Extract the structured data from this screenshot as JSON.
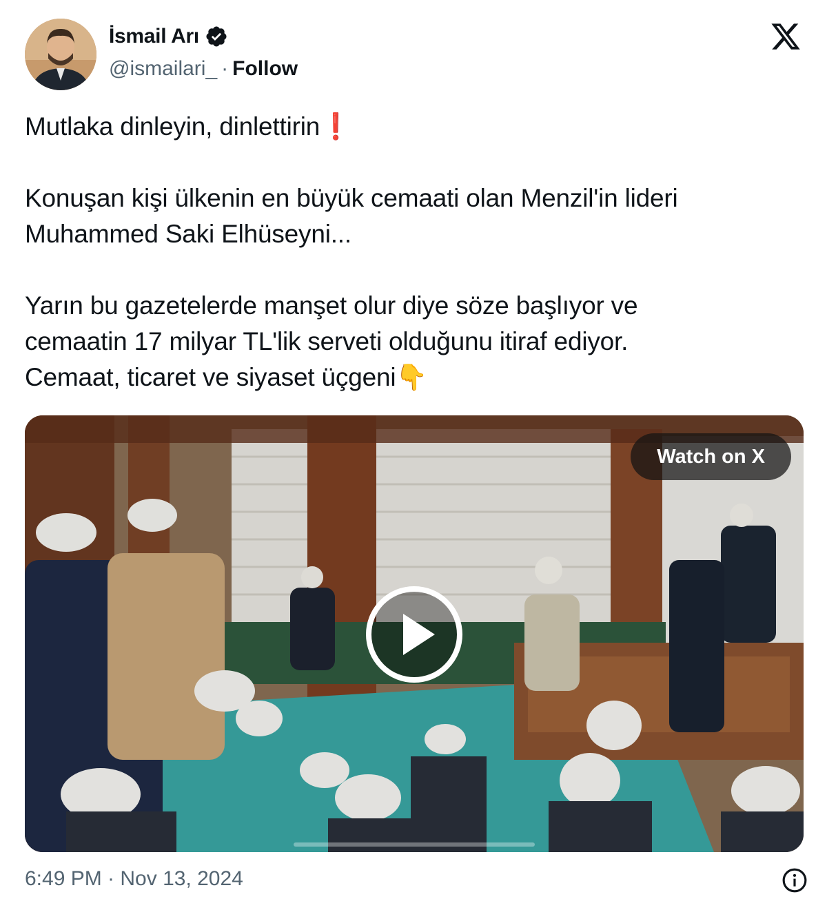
{
  "author": {
    "name": "İsmail Arı",
    "handle": "@ismailari_",
    "separator": "·",
    "follow_label": "Follow",
    "verified": true,
    "avatar_icon": "profile-photo"
  },
  "platform_icon": "x-logo-icon",
  "tweet": {
    "line1": "Mutlaka dinleyin, dinlettirin",
    "line1_emoji": "❗",
    "para2_line1": "Konuşan kişi ülkenin en büyük cemaati olan Menzil'in lideri",
    "para2_line2": "Muhammed Saki Elhüseyni...",
    "para3_line1": "Yarın bu gazetelerde manşet olur diye söze başlıyor ve",
    "para3_line2": "cemaatin 17 milyar TL'lik serveti olduğunu itiraf ediyor.",
    "para3_line3": "Cemaat, ticaret ve siyaset üçgeni",
    "para3_emoji": "👇"
  },
  "media": {
    "watch_label": "Watch on X",
    "play_icon": "play-icon",
    "progress": 0
  },
  "footer": {
    "timestamp": "6:49 PM · Nov 13, 2024",
    "info_icon": "info-icon"
  },
  "colors": {
    "text": "#0f1419",
    "secondary": "#536471",
    "verified_badge": "#0f1419"
  }
}
